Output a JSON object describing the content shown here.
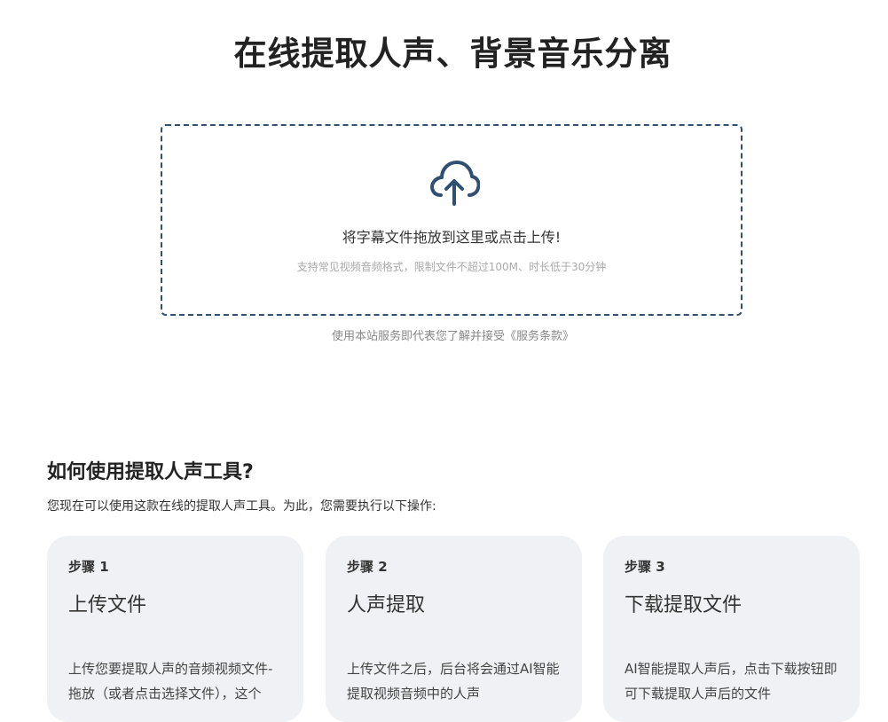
{
  "page": {
    "title": "在线提取人声、背景音乐分离"
  },
  "upload": {
    "icon": "cloud-upload-icon",
    "main_text": "将字幕文件拖放到这里或点击上传!",
    "hint_text": "支持常见视频音频格式，限制文件不超过100M、时长低于30分钟",
    "terms_prefix": "使用本站服务即代表您了解并接受",
    "terms_link": "《服务条款》"
  },
  "howto": {
    "title": "如何使用提取人声工具?",
    "description": "您现在可以使用这款在线的提取人声工具。为此，您需要执行以下操作:",
    "steps": [
      {
        "label": "步骤 1",
        "title": "上传文件",
        "body": "上传您要提取人声的音频视频文件-拖放（或者点击选择文件），这个"
      },
      {
        "label": "步骤 2",
        "title": "人声提取",
        "body": "上传文件之后，后台将会通过AI智能提取视频音频中的人声"
      },
      {
        "label": "步骤 3",
        "title": "下载提取文件",
        "body": "AI智能提取人声后，点击下载按钮即可下载提取人声后的文件"
      }
    ]
  },
  "colors": {
    "accent": "#2f4f73",
    "card_bg": "#f0f1f5"
  }
}
